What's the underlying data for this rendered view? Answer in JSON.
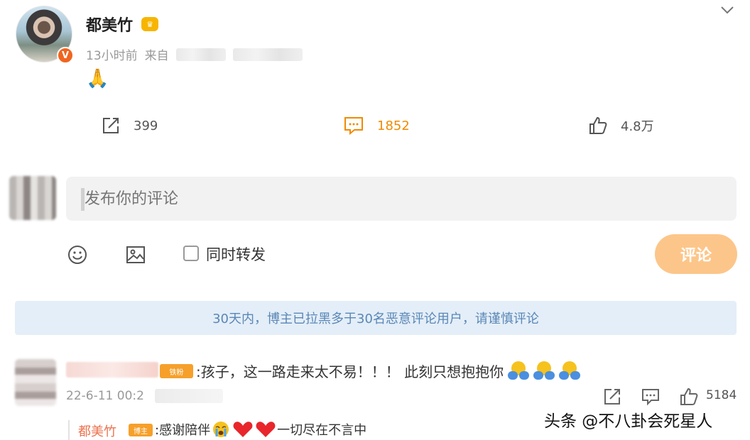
{
  "post": {
    "author": "都美竹",
    "time": "13小时前",
    "source_prefix": "来自",
    "content": "🙏",
    "repost_count": "399",
    "comment_count": "1852",
    "like_count": "4.8万",
    "icons": {
      "verified": "v-badge",
      "level": "vip-crown-icon",
      "menu": "chevron-down-icon"
    }
  },
  "composer": {
    "placeholder": "发布你的评论",
    "sync_label": "同时转发",
    "submit_label": "评论",
    "icons": [
      "emoji-icon",
      "image-icon"
    ]
  },
  "notice": {
    "text": "30天内，博主已拉黑多于30名恶意评论用户，请谨慎评论"
  },
  "comments": [
    {
      "badge": "铁粉",
      "text": ":孩子，这一路走来太不易！！！ 此刻只想抱抱你",
      "time": "22-6-11 00:2",
      "like_count": "5184",
      "reply": {
        "author": "都美竹",
        "badge": "博主",
        "text_before": ":感谢陪伴",
        "text_after": "一切尽在不言中"
      }
    }
  ],
  "watermark": "头条 @不八卦会死星人",
  "colors": {
    "accent_orange": "#f08a00",
    "submit_disabled": "#fcc68a",
    "notice_bg": "#e4eef8",
    "notice_text": "#5a87b6",
    "reply_name": "#eb7350"
  }
}
